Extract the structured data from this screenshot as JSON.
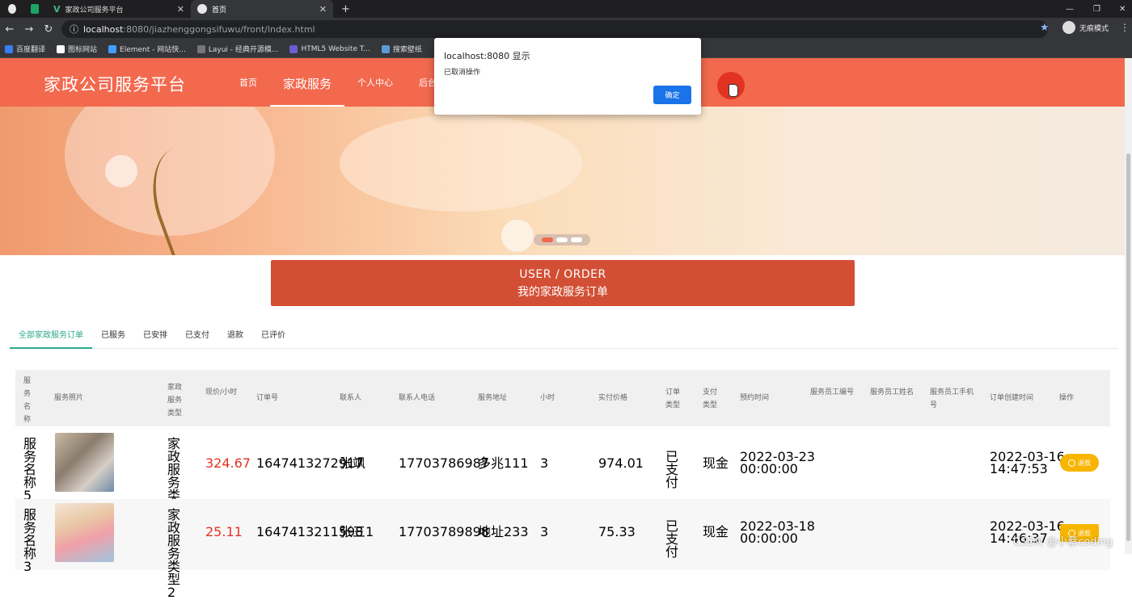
{
  "browser": {
    "tabs": [
      {
        "title": ""
      },
      {
        "title": ""
      },
      {
        "title": "家政公司服务平台"
      },
      {
        "title": "首页"
      }
    ],
    "new_tab": "+",
    "url_host": "localhost",
    "url_rest": ":8080/jiazhenggongsifuwu/front/index.html",
    "incognito_label": "无痕模式",
    "bookmarks": [
      "百度翻译",
      "图标网站",
      "Element - 网站快...",
      "Layui - 经典开源模...",
      "HTML5 Website T...",
      "搜索壁纸"
    ],
    "win_min": "—",
    "win_max": "❐",
    "win_close": "✕"
  },
  "header": {
    "logo": "家政公司服务平台",
    "nav": [
      "首页",
      "家政服务",
      "个人中心",
      "后台"
    ]
  },
  "dialog": {
    "title": "localhost:8080 显示",
    "message": "已取消操作",
    "ok": "确定"
  },
  "title_bar": {
    "line1": "USER / ORDER",
    "line2": "我的家政服务订单"
  },
  "filter_tabs": [
    "全部家政服务订单",
    "已服务",
    "已安排",
    "已支付",
    "退款",
    "已评价"
  ],
  "table": {
    "headers": [
      "服务名称",
      "服务照片",
      "家政服务类型",
      "现价/小时",
      "订单号",
      "联系人",
      "联系人电话",
      "服务地址",
      "小时",
      "实付价格",
      "订单类型",
      "支付类型",
      "预约时间",
      "服务员工编号",
      "服务员工姓名",
      "服务员工手机号",
      "订单创建时间",
      "操作"
    ],
    "rows": [
      {
        "name": "服务名称5",
        "type": "家政服务类型1",
        "price": "324.67",
        "order_no": "1647413272917",
        "contact": "张飒",
        "phone": "17703786987",
        "address": "多兆111",
        "hours": "3",
        "paid": "974.01",
        "order_type": "已支付",
        "pay_type": "现金",
        "booking_date": "2022-03-23",
        "booking_time": "00:00:00",
        "created_date": "2022-03-16",
        "created_time": "14:47:53",
        "action": "退款"
      },
      {
        "name": "服务名称3",
        "type": "家政服务类型2",
        "price": "25.11",
        "order_no": "1647413211598",
        "contact": "张三1",
        "phone": "17703789898",
        "address": "地址233",
        "hours": "3",
        "paid": "75.33",
        "order_type": "已支付",
        "pay_type": "现金",
        "booking_date": "2022-03-18",
        "booking_time": "00:00:00",
        "created_date": "2022-03-16",
        "created_time": "14:46:37",
        "action": "退款"
      }
    ]
  },
  "watermark": "CSDN @小蔡coding",
  "colors": {
    "primary": "#f2694e",
    "title_bar": "#d24f35",
    "active_tab": "#2ea88a",
    "refund": "#f7b500",
    "price": "#e23322",
    "dialog_btn": "#1a73e8"
  }
}
